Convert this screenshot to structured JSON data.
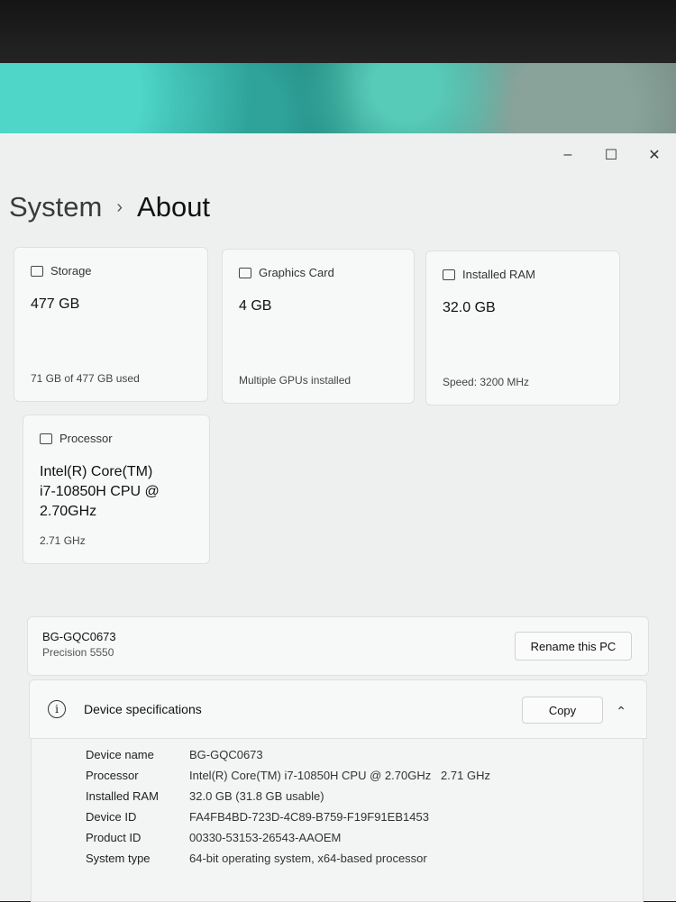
{
  "breadcrumb": {
    "parent": "System",
    "separator": "›",
    "current": "About"
  },
  "window_controls": {
    "minimize": "–",
    "maximize": "☐",
    "close": "✕"
  },
  "cards": {
    "storage": {
      "title": "Storage",
      "value": "477 GB",
      "sub": "71 GB of 477 GB used"
    },
    "graphics": {
      "title": "Graphics Card",
      "value": "4 GB",
      "sub": "Multiple GPUs installed"
    },
    "ram": {
      "title": "Installed RAM",
      "value": "32.0 GB",
      "sub": "Speed: 3200 MHz"
    },
    "processor": {
      "title": "Processor",
      "value_line1": "Intel(R) Core(TM)",
      "value_line2": "i7-10850H CPU @",
      "value_line3": "2.70GHz",
      "sub": "2.71 GHz"
    }
  },
  "pc": {
    "name": "BG-GQC0673",
    "model": "Precision 5550",
    "rename_label": "Rename this PC"
  },
  "specs": {
    "title": "Device specifications",
    "info_glyph": "i",
    "copy_label": "Copy",
    "chevron": "⌃",
    "rows": [
      {
        "label": "Device name",
        "value": "BG-GQC0673"
      },
      {
        "label": "Processor",
        "value": "Intel(R) Core(TM) i7-10850H CPU @ 2.70GHz   2.71 GHz"
      },
      {
        "label": "Installed RAM",
        "value": "32.0 GB (31.8 GB usable)"
      },
      {
        "label": "Device ID",
        "value": "FA4FB4BD-723D-4C89-B759-F19F91EB1453"
      },
      {
        "label": "Product ID",
        "value": "00330-53153-26543-AAOEM"
      },
      {
        "label": "System type",
        "value": "64-bit operating system, x64-based processor"
      }
    ]
  }
}
